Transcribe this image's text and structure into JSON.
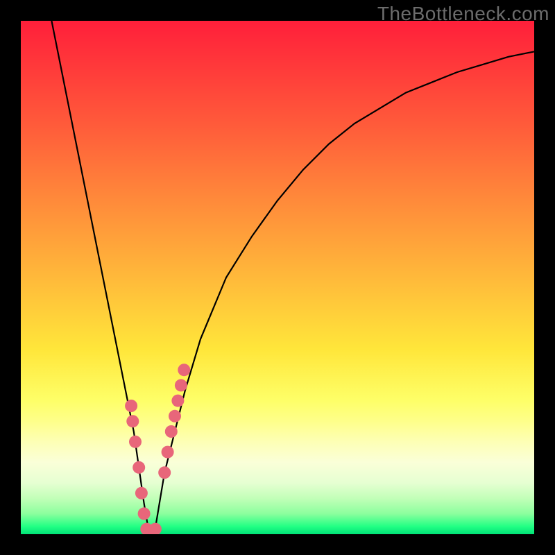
{
  "watermark": "TheBottleneck.com",
  "chart_data": {
    "type": "line",
    "title": "",
    "xlabel": "",
    "ylabel": "",
    "xlim": [
      0,
      100
    ],
    "ylim": [
      0,
      100
    ],
    "series": [
      {
        "name": "bottleneck-curve",
        "x": [
          6,
          8,
          10,
          12,
          14,
          16,
          18,
          20,
          21,
          22,
          23,
          24,
          25,
          26,
          27,
          28,
          30,
          32,
          35,
          40,
          45,
          50,
          55,
          60,
          65,
          70,
          75,
          80,
          85,
          90,
          95,
          100
        ],
        "values": [
          100,
          90,
          80,
          70,
          60,
          50,
          40,
          30,
          25,
          20,
          13,
          6,
          0,
          0,
          6,
          12,
          20,
          28,
          38,
          50,
          58,
          65,
          71,
          76,
          80,
          83,
          86,
          88,
          90,
          91.5,
          93,
          94
        ]
      }
    ],
    "markers": {
      "name": "highlighted-points",
      "color": "#e8667a",
      "x": [
        21.5,
        21.8,
        22.3,
        23.0,
        23.5,
        24.0,
        24.5,
        25.0,
        25.6,
        26.2,
        28.0,
        28.6,
        29.3,
        30.0,
        30.6,
        31.2,
        31.8
      ],
      "values": [
        25,
        22,
        18,
        13,
        8,
        4,
        1,
        0,
        0,
        1,
        12,
        16,
        20,
        23,
        26,
        29,
        32
      ]
    },
    "gradient_stops": [
      {
        "pos": 0,
        "color": "#ff1f3a"
      },
      {
        "pos": 50,
        "color": "#ffb93a"
      },
      {
        "pos": 75,
        "color": "#feff68"
      },
      {
        "pos": 100,
        "color": "#00e277"
      }
    ]
  }
}
